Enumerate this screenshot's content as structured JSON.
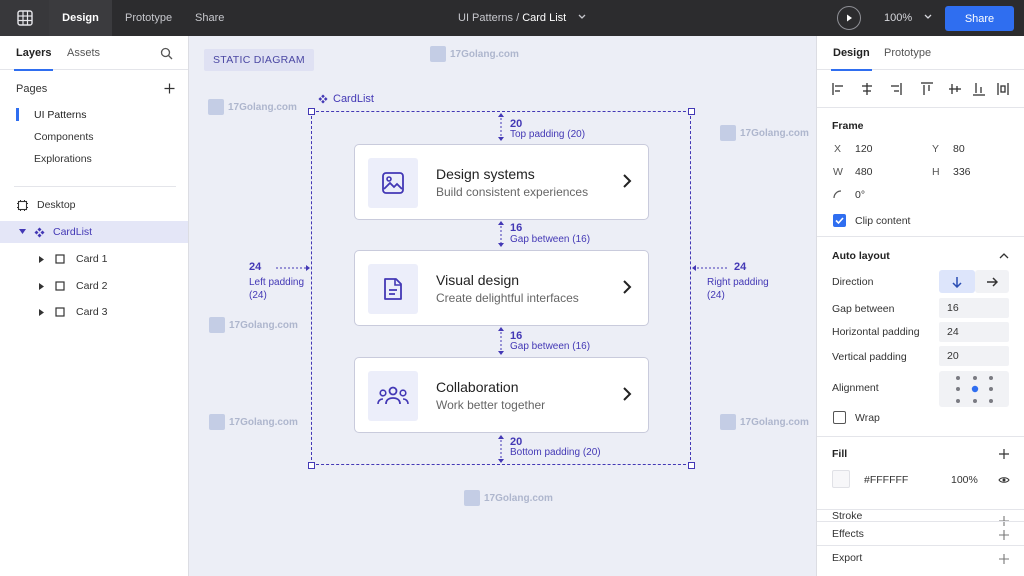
{
  "topbar": {
    "tabs": [
      "Design",
      "Prototype",
      "Share"
    ],
    "title_project": "UI Patterns / ",
    "title_page": "Card List",
    "zoom": "100%",
    "share_button": "Share"
  },
  "left_panel": {
    "tabs": [
      "Layers",
      "Assets"
    ],
    "pages_heading": "Pages",
    "pages": [
      "UI Patterns",
      "Components",
      "Explorations"
    ],
    "layers": [
      {
        "label": "Desktop",
        "icon": "frame-icon"
      },
      {
        "label": "CardList",
        "icon": "component-icon"
      },
      {
        "label": "Card 1",
        "icon": "square-icon"
      },
      {
        "label": "Card 2",
        "icon": "square-icon"
      },
      {
        "label": "Card 3",
        "icon": "square-icon"
      }
    ]
  },
  "canvas": {
    "badge": "STATIC DIAGRAM",
    "frame_label": "CardList",
    "watermark": "17Golang.com",
    "cards": [
      {
        "title": "Design systems",
        "subtitle": "Build consistent experiences",
        "icon": "image-icon"
      },
      {
        "title": "Visual design",
        "subtitle": "Create delightful interfaces",
        "icon": "document-icon"
      },
      {
        "title": "Collaboration",
        "subtitle": "Work better together",
        "icon": "people-icon"
      }
    ],
    "annotations": {
      "top_value": "20",
      "top_label": "Top padding (20)",
      "gap1_value": "16",
      "gap1_label": "Gap between (16)",
      "gap2_value": "16",
      "gap2_label": "Gap between (16)",
      "bottom_value": "20",
      "bottom_label": "Bottom padding (20)",
      "left_value": "24",
      "left_label1": "Left padding",
      "left_label2": "(24)",
      "right_value": "24",
      "right_label1": "Right padding",
      "right_label2": "(24)"
    }
  },
  "right_panel": {
    "tabs": [
      "Design",
      "Prototype"
    ],
    "frame": {
      "heading": "Frame",
      "x_label": "X",
      "x": "120",
      "y_label": "Y",
      "y": "80",
      "w_label": "W",
      "w": "480",
      "h_label": "H",
      "h": "336",
      "rotation": "0°",
      "clip_content": "Clip content"
    },
    "auto_layout": {
      "heading": "Auto layout",
      "direction": "Direction",
      "gap_label": "Gap between",
      "gap": "16",
      "hpad_label": "Horizontal padding",
      "hpad": "24",
      "vpad_label": "Vertical padding",
      "vpad": "20",
      "alignment": "Alignment",
      "wrap": "Wrap"
    },
    "fill": {
      "heading": "Fill",
      "color": "#FFFFFF",
      "opacity": "100%"
    },
    "stroke": "Stroke",
    "effects": "Effects",
    "export": "Export"
  },
  "colors": {
    "accent": "#2f6ef0",
    "annotation": "#4338b5",
    "topbar": "#2c2c2e"
  }
}
